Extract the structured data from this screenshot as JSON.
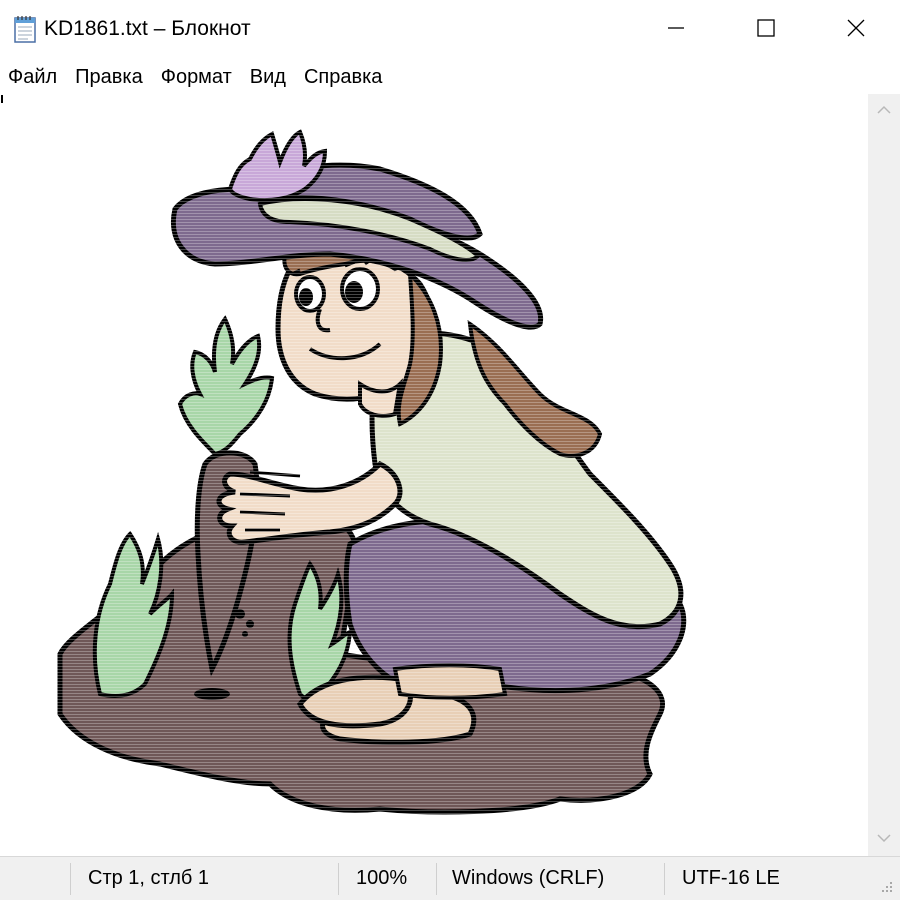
{
  "window": {
    "title": "KD1861.txt – Блокнот",
    "app_icon": "notepad-icon",
    "controls": {
      "minimize_icon": "minimize-icon",
      "maximize_icon": "maximize-icon",
      "close_icon": "close-icon"
    }
  },
  "menu": {
    "items": [
      {
        "label": "Файл"
      },
      {
        "label": "Правка"
      },
      {
        "label": "Формат"
      },
      {
        "label": "Вид"
      },
      {
        "label": "Справка"
      }
    ]
  },
  "editor": {
    "content_description_icon": "ascii-art-girl-with-carrot",
    "colors": {
      "hat": "#7e6a8e",
      "hat_band": "#d6dcc4",
      "feather": "#c8a8d8",
      "skin": "#f1dcc8",
      "hair": "#9a6e52",
      "shirt": "#dde3cc",
      "pants": "#7e6a8e",
      "soil": "#6f5757",
      "leaves": "#a8d6a8",
      "carrot": "#6e5858",
      "boots": "#e8cfb6",
      "outline": "#000000"
    }
  },
  "scrollbar": {
    "up_icon": "chevron-up-icon",
    "down_icon": "chevron-down-icon"
  },
  "status": {
    "position": "Стр 1, стлб 1",
    "zoom": "100%",
    "line_ending": "Windows (CRLF)",
    "encoding": "UTF-16 LE",
    "grip_icon": "resize-grip-icon"
  }
}
